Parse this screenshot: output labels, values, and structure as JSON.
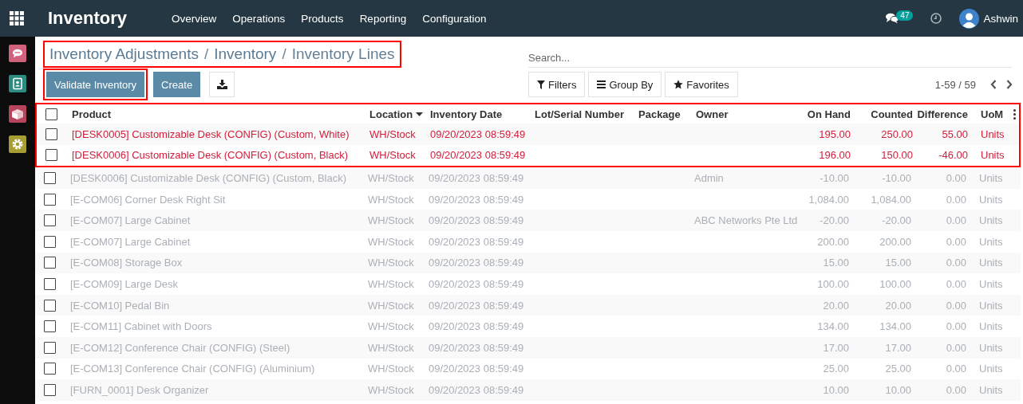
{
  "topbar": {
    "app_title": "Inventory",
    "menu": [
      "Overview",
      "Operations",
      "Products",
      "Reporting",
      "Configuration"
    ],
    "messages_badge": "47",
    "user": "Ashwin"
  },
  "breadcrumb": {
    "highlighted": true,
    "parts": [
      {
        "kind": "link",
        "text": "Inventory Adjustments"
      },
      {
        "kind": "separator",
        "text": "/"
      },
      {
        "kind": "link",
        "text": "Inventory"
      },
      {
        "kind": "separator",
        "text": "/"
      },
      {
        "kind": "current",
        "text": "Inventory Lines"
      }
    ]
  },
  "search": {
    "placeholder": "Search..."
  },
  "buttons": [
    {
      "kind": "primary",
      "label": "Validate Inventory",
      "highlighted": true
    },
    {
      "kind": "primary",
      "label": "Create",
      "highlighted": false
    },
    {
      "kind": "download",
      "highlighted": false
    }
  ],
  "search_options": [
    {
      "kind": "filter",
      "label": "Filters"
    },
    {
      "kind": "group",
      "label": "Group By"
    },
    {
      "kind": "star",
      "label": "Favorites"
    }
  ],
  "pager": "1-59 / 59",
  "table": {
    "header_highlighted": true,
    "header_checked": false,
    "columns": [
      {
        "label": "Product",
        "kind": "text",
        "sorted": false
      },
      {
        "label": "Location",
        "kind": "text",
        "sorted": true
      },
      {
        "label": "Inventory Date",
        "kind": "text",
        "sorted": false
      },
      {
        "label": "Lot/Serial Number",
        "kind": "text",
        "sorted": false
      },
      {
        "label": "Package",
        "kind": "text",
        "sorted": false
      },
      {
        "label": "Owner",
        "kind": "text",
        "sorted": false
      },
      {
        "label": "On Hand",
        "kind": "number",
        "sorted": false
      },
      {
        "label": "Counted",
        "kind": "number",
        "sorted": false
      },
      {
        "label": "Difference",
        "kind": "number",
        "sorted": false
      },
      {
        "label": "UoM",
        "kind": "text",
        "sorted": false
      }
    ],
    "rows": [
      {
        "kind": "changed",
        "highlighted": true,
        "checked": false,
        "cells": [
          "[DESK0005] Customizable Desk (CONFIG) (Custom, White)",
          "WH/Stock",
          "09/20/2023 08:59:49",
          null,
          null,
          null,
          "195.00",
          "250.00",
          "55.00",
          "Units"
        ]
      },
      {
        "kind": "changed",
        "highlighted": true,
        "checked": false,
        "cells": [
          "[DESK0006] Customizable Desk (CONFIG) (Custom, Black)",
          "WH/Stock",
          "09/20/2023 08:59:49",
          null,
          null,
          null,
          "196.00",
          "150.00",
          "-46.00",
          "Units"
        ]
      },
      {
        "kind": "unchanged",
        "highlighted": false,
        "checked": false,
        "cells": [
          "[DESK0006] Customizable Desk (CONFIG) (Custom, Black)",
          "WH/Stock",
          "09/20/2023 08:59:49",
          null,
          null,
          "Admin",
          "-10.00",
          "-10.00",
          "0.00",
          "Units"
        ]
      },
      {
        "kind": "unchanged",
        "highlighted": false,
        "checked": false,
        "cells": [
          "[E-COM06] Corner Desk Right Sit",
          "WH/Stock",
          "09/20/2023 08:59:49",
          null,
          null,
          null,
          "1,084.00",
          "1,084.00",
          "0.00",
          "Units"
        ]
      },
      {
        "kind": "unchanged",
        "highlighted": false,
        "checked": false,
        "cells": [
          "[E-COM07] Large Cabinet",
          "WH/Stock",
          "09/20/2023 08:59:49",
          null,
          null,
          "ABC Networks Pte Ltd",
          "-20.00",
          "-20.00",
          "0.00",
          "Units"
        ]
      },
      {
        "kind": "unchanged",
        "highlighted": false,
        "checked": false,
        "cells": [
          "[E-COM07] Large Cabinet",
          "WH/Stock",
          "09/20/2023 08:59:49",
          null,
          null,
          null,
          "200.00",
          "200.00",
          "0.00",
          "Units"
        ]
      },
      {
        "kind": "unchanged",
        "highlighted": false,
        "checked": false,
        "cells": [
          "[E-COM08] Storage Box",
          "WH/Stock",
          "09/20/2023 08:59:49",
          null,
          null,
          null,
          "15.00",
          "15.00",
          "0.00",
          "Units"
        ]
      },
      {
        "kind": "unchanged",
        "highlighted": false,
        "checked": false,
        "cells": [
          "[E-COM09] Large Desk",
          "WH/Stock",
          "09/20/2023 08:59:49",
          null,
          null,
          null,
          "100.00",
          "100.00",
          "0.00",
          "Units"
        ]
      },
      {
        "kind": "unchanged",
        "highlighted": false,
        "checked": false,
        "cells": [
          "[E-COM10] Pedal Bin",
          "WH/Stock",
          "09/20/2023 08:59:49",
          null,
          null,
          null,
          "20.00",
          "20.00",
          "0.00",
          "Units"
        ]
      },
      {
        "kind": "unchanged",
        "highlighted": false,
        "checked": false,
        "cells": [
          "[E-COM11] Cabinet with Doors",
          "WH/Stock",
          "09/20/2023 08:59:49",
          null,
          null,
          null,
          "134.00",
          "134.00",
          "0.00",
          "Units"
        ]
      },
      {
        "kind": "unchanged",
        "highlighted": false,
        "checked": false,
        "cells": [
          "[E-COM12] Conference Chair (CONFIG) (Steel)",
          "WH/Stock",
          "09/20/2023 08:59:49",
          null,
          null,
          null,
          "17.00",
          "17.00",
          "0.00",
          "Units"
        ]
      },
      {
        "kind": "unchanged",
        "highlighted": false,
        "checked": false,
        "cells": [
          "[E-COM13] Conference Chair (CONFIG) (Aluminium)",
          "WH/Stock",
          "09/20/2023 08:59:49",
          null,
          null,
          null,
          "25.00",
          "25.00",
          "0.00",
          "Units"
        ]
      },
      {
        "kind": "unchanged",
        "highlighted": false,
        "checked": false,
        "cells": [
          "[FURN_0001] Desk Organizer",
          "WH/Stock",
          "09/20/2023 08:59:49",
          null,
          null,
          null,
          "10.00",
          "10.00",
          "0.00",
          "Units"
        ]
      }
    ]
  }
}
